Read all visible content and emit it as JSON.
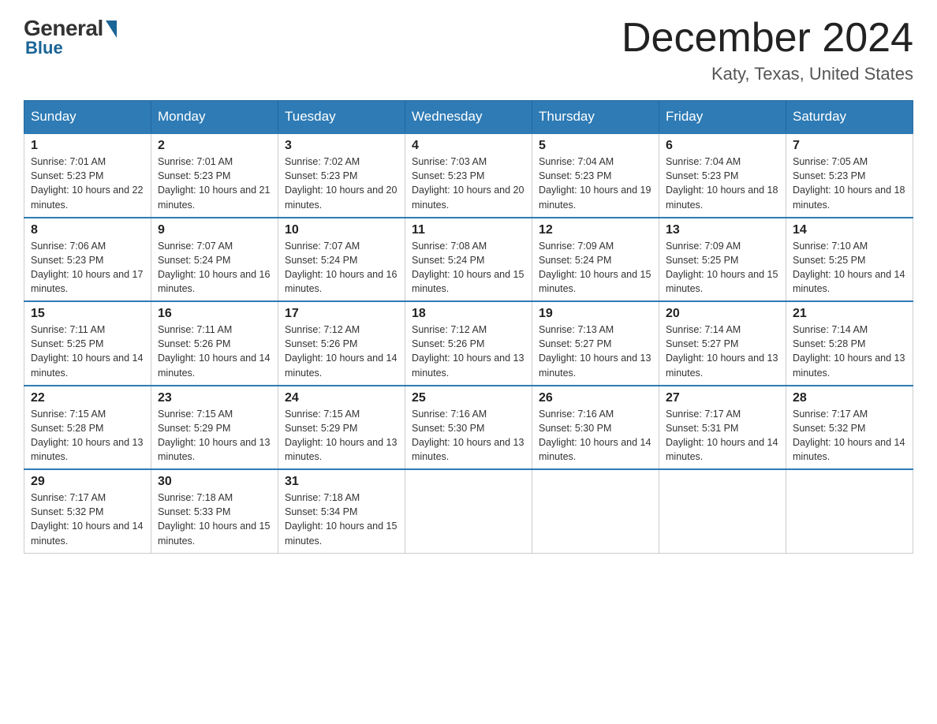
{
  "header": {
    "logo_general": "General",
    "logo_blue": "Blue",
    "month_year": "December 2024",
    "location": "Katy, Texas, United States"
  },
  "days_of_week": [
    "Sunday",
    "Monday",
    "Tuesday",
    "Wednesday",
    "Thursday",
    "Friday",
    "Saturday"
  ],
  "weeks": [
    [
      {
        "day": "1",
        "sunrise": "7:01 AM",
        "sunset": "5:23 PM",
        "daylight": "10 hours and 22 minutes."
      },
      {
        "day": "2",
        "sunrise": "7:01 AM",
        "sunset": "5:23 PM",
        "daylight": "10 hours and 21 minutes."
      },
      {
        "day": "3",
        "sunrise": "7:02 AM",
        "sunset": "5:23 PM",
        "daylight": "10 hours and 20 minutes."
      },
      {
        "day": "4",
        "sunrise": "7:03 AM",
        "sunset": "5:23 PM",
        "daylight": "10 hours and 20 minutes."
      },
      {
        "day": "5",
        "sunrise": "7:04 AM",
        "sunset": "5:23 PM",
        "daylight": "10 hours and 19 minutes."
      },
      {
        "day": "6",
        "sunrise": "7:04 AM",
        "sunset": "5:23 PM",
        "daylight": "10 hours and 18 minutes."
      },
      {
        "day": "7",
        "sunrise": "7:05 AM",
        "sunset": "5:23 PM",
        "daylight": "10 hours and 18 minutes."
      }
    ],
    [
      {
        "day": "8",
        "sunrise": "7:06 AM",
        "sunset": "5:23 PM",
        "daylight": "10 hours and 17 minutes."
      },
      {
        "day": "9",
        "sunrise": "7:07 AM",
        "sunset": "5:24 PM",
        "daylight": "10 hours and 16 minutes."
      },
      {
        "day": "10",
        "sunrise": "7:07 AM",
        "sunset": "5:24 PM",
        "daylight": "10 hours and 16 minutes."
      },
      {
        "day": "11",
        "sunrise": "7:08 AM",
        "sunset": "5:24 PM",
        "daylight": "10 hours and 15 minutes."
      },
      {
        "day": "12",
        "sunrise": "7:09 AM",
        "sunset": "5:24 PM",
        "daylight": "10 hours and 15 minutes."
      },
      {
        "day": "13",
        "sunrise": "7:09 AM",
        "sunset": "5:25 PM",
        "daylight": "10 hours and 15 minutes."
      },
      {
        "day": "14",
        "sunrise": "7:10 AM",
        "sunset": "5:25 PM",
        "daylight": "10 hours and 14 minutes."
      }
    ],
    [
      {
        "day": "15",
        "sunrise": "7:11 AM",
        "sunset": "5:25 PM",
        "daylight": "10 hours and 14 minutes."
      },
      {
        "day": "16",
        "sunrise": "7:11 AM",
        "sunset": "5:26 PM",
        "daylight": "10 hours and 14 minutes."
      },
      {
        "day": "17",
        "sunrise": "7:12 AM",
        "sunset": "5:26 PM",
        "daylight": "10 hours and 14 minutes."
      },
      {
        "day": "18",
        "sunrise": "7:12 AM",
        "sunset": "5:26 PM",
        "daylight": "10 hours and 13 minutes."
      },
      {
        "day": "19",
        "sunrise": "7:13 AM",
        "sunset": "5:27 PM",
        "daylight": "10 hours and 13 minutes."
      },
      {
        "day": "20",
        "sunrise": "7:14 AM",
        "sunset": "5:27 PM",
        "daylight": "10 hours and 13 minutes."
      },
      {
        "day": "21",
        "sunrise": "7:14 AM",
        "sunset": "5:28 PM",
        "daylight": "10 hours and 13 minutes."
      }
    ],
    [
      {
        "day": "22",
        "sunrise": "7:15 AM",
        "sunset": "5:28 PM",
        "daylight": "10 hours and 13 minutes."
      },
      {
        "day": "23",
        "sunrise": "7:15 AM",
        "sunset": "5:29 PM",
        "daylight": "10 hours and 13 minutes."
      },
      {
        "day": "24",
        "sunrise": "7:15 AM",
        "sunset": "5:29 PM",
        "daylight": "10 hours and 13 minutes."
      },
      {
        "day": "25",
        "sunrise": "7:16 AM",
        "sunset": "5:30 PM",
        "daylight": "10 hours and 13 minutes."
      },
      {
        "day": "26",
        "sunrise": "7:16 AM",
        "sunset": "5:30 PM",
        "daylight": "10 hours and 14 minutes."
      },
      {
        "day": "27",
        "sunrise": "7:17 AM",
        "sunset": "5:31 PM",
        "daylight": "10 hours and 14 minutes."
      },
      {
        "day": "28",
        "sunrise": "7:17 AM",
        "sunset": "5:32 PM",
        "daylight": "10 hours and 14 minutes."
      }
    ],
    [
      {
        "day": "29",
        "sunrise": "7:17 AM",
        "sunset": "5:32 PM",
        "daylight": "10 hours and 14 minutes."
      },
      {
        "day": "30",
        "sunrise": "7:18 AM",
        "sunset": "5:33 PM",
        "daylight": "10 hours and 15 minutes."
      },
      {
        "day": "31",
        "sunrise": "7:18 AM",
        "sunset": "5:34 PM",
        "daylight": "10 hours and 15 minutes."
      },
      {
        "day": "",
        "sunrise": "",
        "sunset": "",
        "daylight": ""
      },
      {
        "day": "",
        "sunrise": "",
        "sunset": "",
        "daylight": ""
      },
      {
        "day": "",
        "sunrise": "",
        "sunset": "",
        "daylight": ""
      },
      {
        "day": "",
        "sunrise": "",
        "sunset": "",
        "daylight": ""
      }
    ]
  ],
  "labels": {
    "sunrise_prefix": "Sunrise: ",
    "sunset_prefix": "Sunset: ",
    "daylight_prefix": "Daylight: "
  }
}
